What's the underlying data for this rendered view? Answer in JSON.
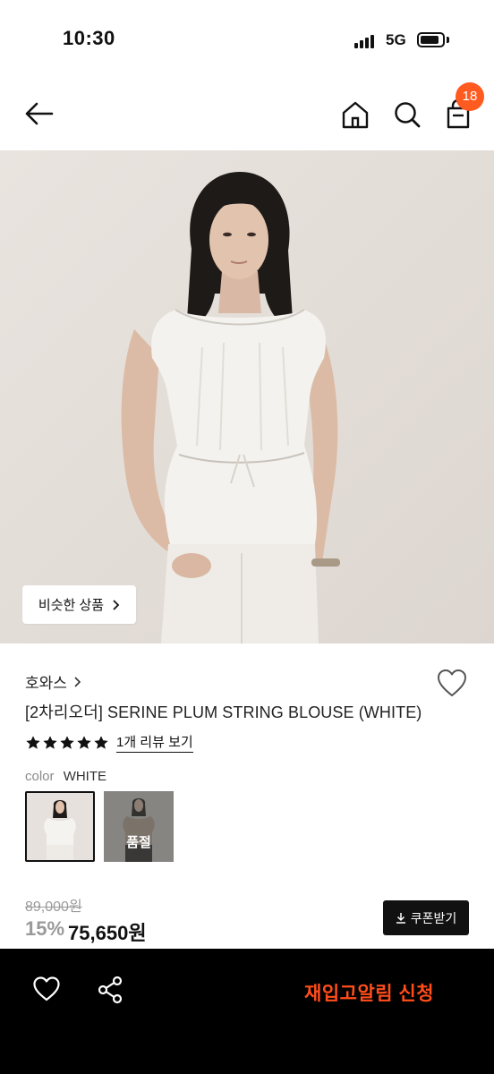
{
  "status_bar": {
    "time": "10:30",
    "network": "5G"
  },
  "header": {
    "back_icon": "arrow-left-icon",
    "home_icon": "home-icon",
    "search_icon": "search-icon",
    "cart_icon": "shopping-bag-icon",
    "cart_count": "18",
    "badge_color": "#ff5a1f"
  },
  "product": {
    "similar_button": "비슷한 상품",
    "brand": "호와스",
    "title": "[2차리오더] SERINE PLUM STRING BLOUSE (WHITE)",
    "rating": 5,
    "review_link": "1개 리뷰 보기",
    "color_label": "color",
    "color_value": "WHITE",
    "swatches": [
      {
        "state": "selected"
      },
      {
        "state": "soldout",
        "label": "품절"
      }
    ],
    "original_price": "89,000원",
    "discount": "15%",
    "sale_price": "75,650원",
    "coupon_button": "쿠폰받기"
  },
  "bottom_bar": {
    "wish_icon": "heart-icon",
    "share_icon": "share-icon",
    "restock_button": "재입고알림 신청",
    "accent_color": "#ff4d1a"
  }
}
